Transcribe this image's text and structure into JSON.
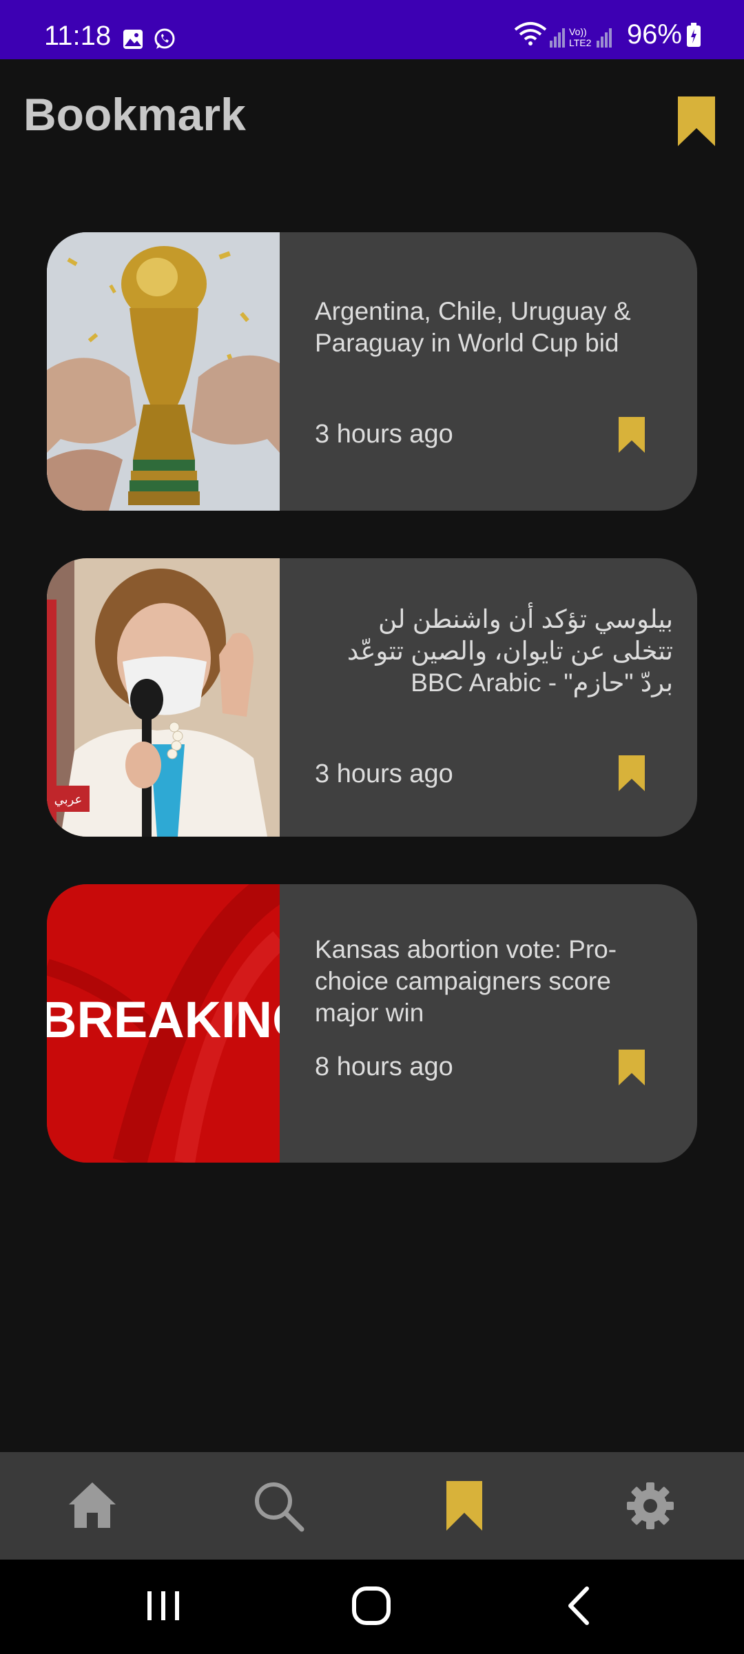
{
  "status_bar": {
    "time": "11:18",
    "battery": "96%",
    "background": "#3d00b3"
  },
  "header": {
    "title": "Bookmark",
    "accent": "#d8b23a"
  },
  "articles": [
    {
      "title": "Argentina, Chile, Uruguay & Paraguay in World Cup bid",
      "time": "3 hours ago",
      "image": "world-cup-trophy"
    },
    {
      "title": "بيلوسي تؤكد أن واشنطن لن تتخلى عن تايوان، والصين تتوعّد بردّ \"حازم\" - BBC Arabic",
      "time": "3 hours ago",
      "image": "pelosi-speaking",
      "badge": "عربي"
    },
    {
      "title": "Kansas abortion vote: Pro-choice campaigners score major win",
      "time": "8 hours ago",
      "image": "breaking-news",
      "image_text": "BREAKING"
    }
  ],
  "bottom_nav": {
    "items": [
      "home-icon",
      "search-icon",
      "bookmark-icon",
      "settings-icon"
    ],
    "active": "bookmark-icon"
  },
  "system_nav": [
    "recent-apps-icon",
    "home-circle-icon",
    "back-icon"
  ]
}
